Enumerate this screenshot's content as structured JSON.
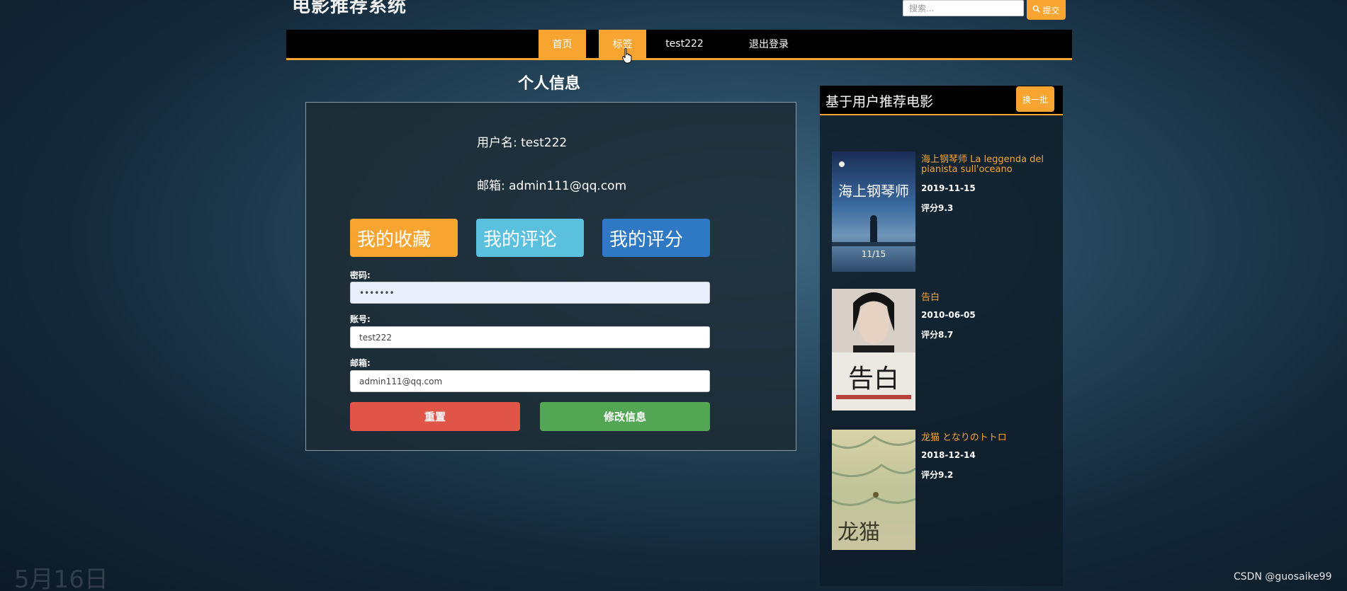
{
  "site": {
    "title": "电影推荐系统"
  },
  "search": {
    "placeholder": "搜索...",
    "submit_label": "提交",
    "submit_icon": "search-icon"
  },
  "nav": {
    "items": [
      {
        "label": "首页",
        "active": true
      },
      {
        "label": "标签",
        "active": true
      },
      {
        "label": "test222",
        "active": false
      },
      {
        "label": "退出登录",
        "active": false
      }
    ]
  },
  "profile": {
    "section_title": "个人信息",
    "username_line": "用户名: test222",
    "email_line": "邮箱: admin111@qq.com",
    "buttons": {
      "favorites": "我的收藏",
      "comments": "我的评论",
      "ratings": "我的评分"
    },
    "form": {
      "password_label": "密码:",
      "password_value": "•••••••",
      "account_label": "账号:",
      "account_value": "test222",
      "email_label": "邮箱:",
      "email_value": "admin111@qq.com",
      "reset_label": "重置",
      "submit_label": "修改信息"
    }
  },
  "recommend": {
    "title": "基于用户推荐电影",
    "swap_label": "换一批",
    "movies": [
      {
        "title": "海上钢琴师 La leggenda del pianista sull'oceano",
        "date": "2019-11-15",
        "score": "评分9.3",
        "poster_text": "海上钢琴师",
        "poster_sub": "11/15"
      },
      {
        "title": "告白",
        "date": "2010-06-05",
        "score": "评分8.7",
        "poster_text": "告白"
      },
      {
        "title": "龙猫 となりのトトロ",
        "date": "2018-12-14",
        "score": "评分9.2",
        "poster_text": "龙猫"
      }
    ]
  },
  "watermarks": {
    "date": "5月16日",
    "csdn": "CSDN @guosaike99"
  },
  "colors": {
    "accent": "#f7a530",
    "nav_bg": "#000000",
    "reset": "#e05547",
    "submit": "#53a653",
    "comments": "#5bc0de",
    "ratings": "#2f79c4"
  }
}
